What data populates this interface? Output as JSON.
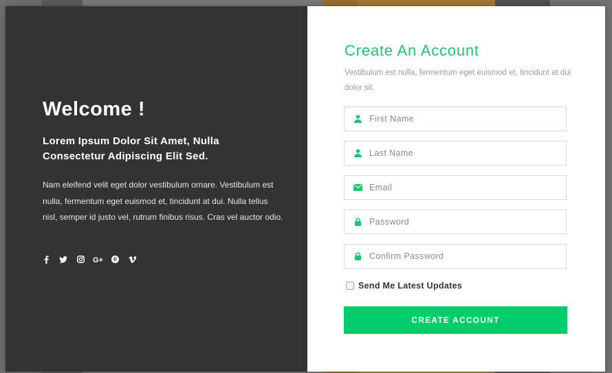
{
  "left_panel": {
    "heading": "Welcome !",
    "tagline": "Lorem Ipsum Dolor Sit Amet, Nulla Consectetur Adipiscing Elit Sed.",
    "description": "Nam eleifend velit eget dolor vestibulum ornare. Vestibulum est nulla, fermentum eget euismod et, tincidunt at dui. Nulla tellus nisl, semper id justo vel, rutrum finibus risus. Cras vel auctor odio.",
    "social_icons": [
      {
        "name": "facebook-icon",
        "glyph": "f"
      },
      {
        "name": "twitter-icon",
        "glyph": "t"
      },
      {
        "name": "instagram-icon",
        "glyph": "ig"
      },
      {
        "name": "google-plus-icon",
        "glyph": "G+"
      },
      {
        "name": "pinterest-icon",
        "glyph": "p"
      },
      {
        "name": "vimeo-icon",
        "glyph": "v"
      }
    ]
  },
  "form": {
    "title": "Create An Account",
    "subtitle": "Vestibulum est nulla, fermentum eget euismod et, tincidunt at dui dolor sit.",
    "fields": {
      "first_name": {
        "placeholder": "First Name",
        "icon": "user-icon"
      },
      "last_name": {
        "placeholder": "Last Name",
        "icon": "user-icon"
      },
      "email": {
        "placeholder": "Email",
        "icon": "envelope-icon"
      },
      "password": {
        "placeholder": "Password",
        "icon": "lock-icon"
      },
      "confirm_password": {
        "placeholder": "Confirm Password",
        "icon": "lock-icon"
      }
    },
    "updates_checkbox": {
      "label": "Send Me Latest Updates",
      "checked": false
    },
    "submit_label": "CREATE ACCOUNT"
  },
  "colors": {
    "accent": "#00cc6a",
    "title_green": "#22c36f",
    "left_panel_bg": "#333333"
  }
}
